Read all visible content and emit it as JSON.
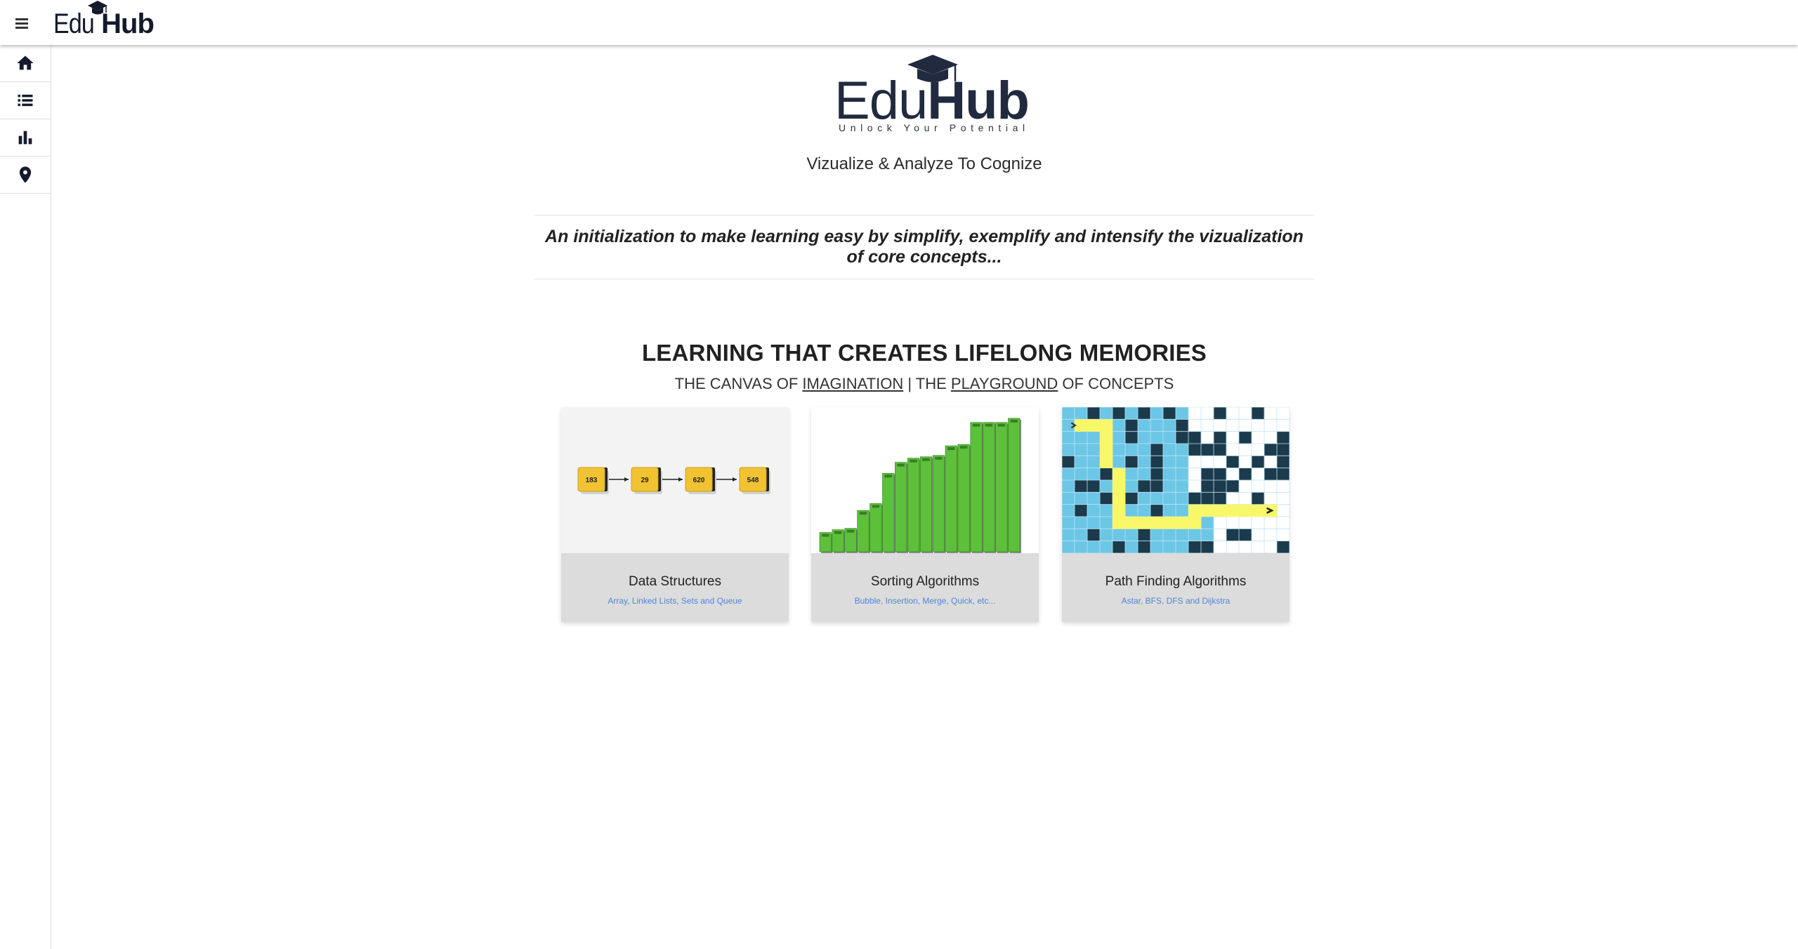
{
  "header": {
    "brand_light": "Edu",
    "brand_bold": "Hub",
    "menu_icon": "hamburger-menu-icon"
  },
  "sidebar": {
    "items": [
      {
        "name": "home",
        "icon": "home-icon"
      },
      {
        "name": "list",
        "icon": "list-icon"
      },
      {
        "name": "chart",
        "icon": "bar-chart-icon"
      },
      {
        "name": "location",
        "icon": "location-pin-icon"
      }
    ]
  },
  "hero": {
    "logo_light": "Edu",
    "logo_bold": "Hub",
    "logo_tagline": "Unlock Your Potential",
    "tagline": "Vizualize & Analyze To Cognize",
    "intro": "An initialization to make learning easy by simplify, exemplify and intensify the vizualization of core concepts..."
  },
  "section": {
    "headline": "LEARNING THAT CREATES LIFELONG MEMORIES",
    "sub_prefix": "THE CANVAS OF ",
    "sub_link1": "IMAGINATION",
    "sub_middle": " | THE ",
    "sub_link2": "PLAYGROUND",
    "sub_suffix": " OF CONCEPTS"
  },
  "cards": [
    {
      "title": "Data Structures",
      "subtitle": "Array, Linked Lists, Sets and Queue",
      "nodes": [
        "183",
        "29",
        "620",
        "548"
      ]
    },
    {
      "title": "Sorting Algorithms",
      "subtitle": "Bubble, Insertion, Merge, Quick, etc...",
      "bar_levels": [
        0.14,
        0.16,
        0.17,
        0.3,
        0.35,
        0.57,
        0.65,
        0.68,
        0.69,
        0.7,
        0.77,
        0.78,
        0.94,
        0.94,
        0.94,
        0.97
      ],
      "bar_color": "#5cc03b"
    },
    {
      "title": "Path Finding Algorithms",
      "subtitle": "Astar, BFS, DFS and Dijkstra"
    }
  ],
  "colors": {
    "accent_link": "#4f86d6",
    "node_fill": "#f1c232",
    "wall": "#1b3a4b",
    "visited": "#6cc6e6",
    "path": "#f8f76a"
  }
}
